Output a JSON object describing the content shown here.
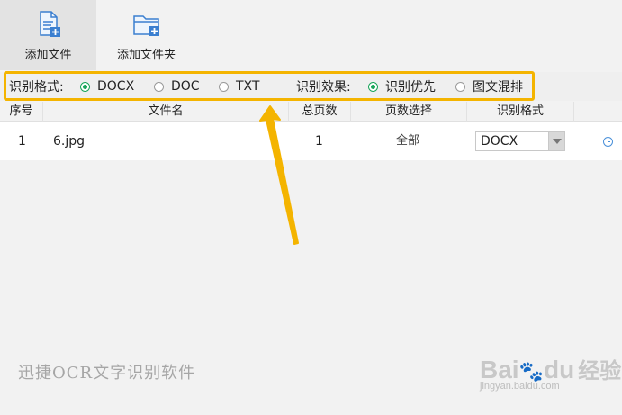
{
  "toolbar": {
    "add_file_label": "添加文件",
    "add_folder_label": "添加文件夹"
  },
  "options": {
    "format_label": "识别格式:",
    "format_options": [
      "DOCX",
      "DOC",
      "TXT"
    ],
    "format_selected": "DOCX",
    "effect_label": "识别效果:",
    "effect_options": [
      "识别优先",
      "图文混排"
    ],
    "effect_selected": "识别优先"
  },
  "table": {
    "columns": [
      "序号",
      "文件名",
      "总页数",
      "页数选择",
      "识别格式"
    ],
    "rows": [
      {
        "index": "1",
        "filename": "6.jpg",
        "pages": "1",
        "page_select": "全部",
        "format": "DOCX"
      }
    ]
  },
  "watermarks": {
    "app_name": "迅捷OCR文字识别软件",
    "baidu_brand": "Bai",
    "baidu_brand2": "du",
    "baidu_jingyan": "经验",
    "baidu_url": "jingyan.baidu.com"
  },
  "colors": {
    "accent_green": "#19a55a",
    "highlight_yellow": "#f4b400",
    "icon_blue": "#4a90d9"
  }
}
